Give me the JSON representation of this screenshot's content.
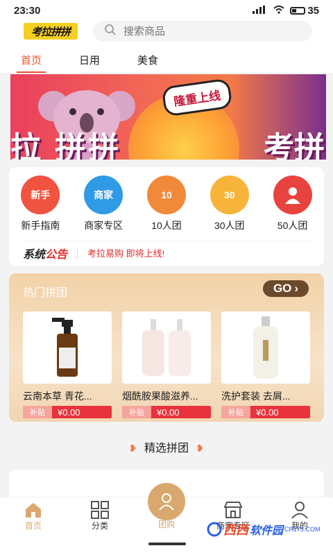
{
  "status": {
    "time": "23:30",
    "battery": "35"
  },
  "header": {
    "logo_text": "考拉拼拼",
    "search_placeholder": "搜索商品"
  },
  "tabs": [
    {
      "label": "首页"
    },
    {
      "label": "日用"
    },
    {
      "label": "美食"
    }
  ],
  "banner": {
    "bubble": "隆重上线",
    "big_text": "拉  拼拼",
    "big_text2": "考拼"
  },
  "categories": [
    {
      "label": "新手指南",
      "icon_text": "新手",
      "color": "#f0533f"
    },
    {
      "label": "商家专区",
      "icon_text": "商家",
      "color": "#2f9ae6"
    },
    {
      "label": "10人团",
      "icon_text": "10",
      "color": "#f08a3a"
    },
    {
      "label": "30人团",
      "icon_text": "30",
      "color": "#f6b53a"
    },
    {
      "label": "50人团",
      "icon_text": "",
      "color": "#e8433f"
    }
  ],
  "notice": {
    "title_left": "系统",
    "title_right": "公告",
    "text": "考拉易购 即将上线!"
  },
  "hot": {
    "title": "热门拼团",
    "go": "GO"
  },
  "products": [
    {
      "name": "云南本草 青花...",
      "tag": "补贴",
      "price": "¥0.00"
    },
    {
      "name": "烟酰胺果酸滋养...",
      "tag": "补贴",
      "price": "¥0.00"
    },
    {
      "name": "洗护套装 去屑...",
      "tag": "补贴",
      "price": "¥0.00"
    }
  ],
  "select": {
    "title": "精选拼团"
  },
  "nav": [
    {
      "label": "首页"
    },
    {
      "label": "分类"
    },
    {
      "label": "团购"
    },
    {
      "label": "商家专区"
    },
    {
      "label": "我的"
    }
  ],
  "watermark": {
    "text1": "西西",
    "text2": "软件园",
    "small": "CR173.COM"
  },
  "colors": {
    "accent": "#e8512c",
    "price_red": "#e8333c",
    "hot_bg": "#f2d2a8"
  }
}
